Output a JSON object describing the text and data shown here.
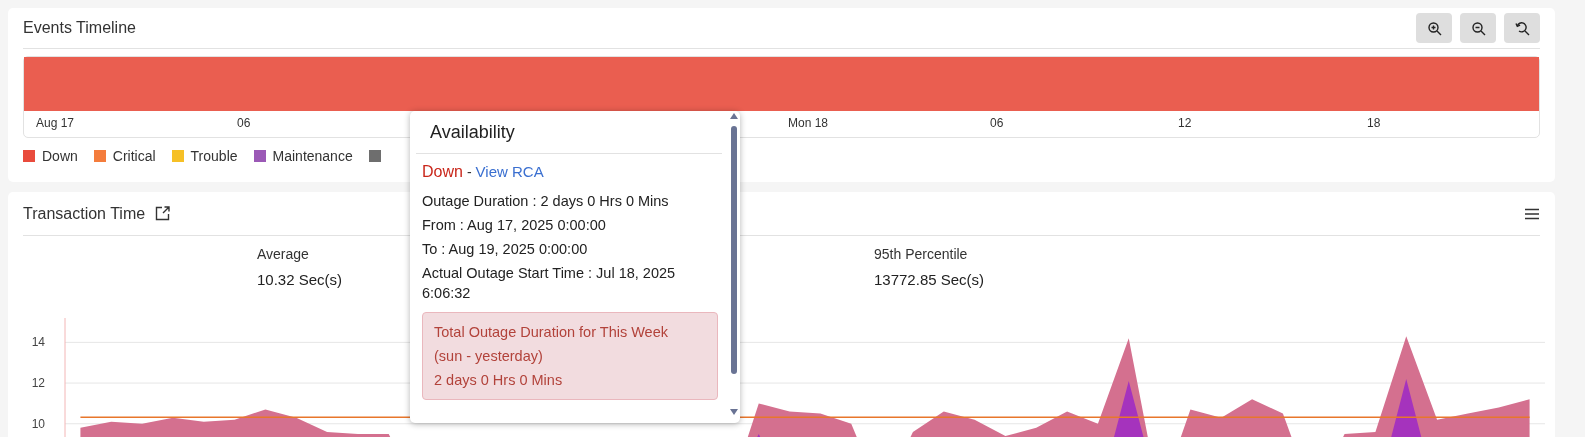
{
  "events_timeline": {
    "title": "Events Timeline",
    "toolbar": [
      {
        "kind": "zoom-in"
      },
      {
        "kind": "zoom-out"
      },
      {
        "kind": "reset"
      }
    ],
    "bar": {
      "color": "#ea5e50"
    },
    "axis_labels": [
      "Aug 17",
      "06",
      "Mon 18",
      "06",
      "12",
      "18"
    ],
    "legend": [
      {
        "label": "Down",
        "color": "#e94b3c"
      },
      {
        "label": "Critical",
        "color": "#f47c3c"
      },
      {
        "label": "Trouble",
        "color": "#f6c026"
      },
      {
        "label": "Maintenance",
        "color": "#9b59b6"
      },
      {
        "color": "#6e6e6e"
      }
    ]
  },
  "transaction_time": {
    "title": "Transaction Time",
    "stats": [
      {
        "label": "Average",
        "value": "10.32 Sec(s)"
      },
      {
        "label": "95th Percentile",
        "value": "13772.85 Sec(s)"
      }
    ],
    "chart_data": {
      "type": "area",
      "yticks": [
        10,
        12,
        14
      ],
      "ylim": [
        9.3,
        15.1
      ],
      "grid": true,
      "series": [
        {
          "color": "#d4708f",
          "values": [
            9.8,
            10.1,
            10.0,
            10.3,
            10.1,
            10.2,
            10.7,
            10.3,
            9.6,
            9.5,
            9.5,
            null,
            null,
            null,
            null,
            null,
            null,
            null,
            null,
            null,
            null,
            null,
            11.0,
            10.6,
            10.5,
            10.0,
            null,
            9.6,
            10.6,
            10.2,
            9.4,
            9.8,
            10.6,
            10.0,
            14.2,
            null,
            10.7,
            10.3,
            11.2,
            10.5,
            null,
            9.5,
            9.6,
            14.3,
            10.2,
            10.5,
            10.8,
            11.2
          ]
        },
        {
          "color": "#a533bd",
          "values": [
            null,
            null,
            null,
            null,
            null,
            null,
            null,
            null,
            null,
            null,
            null,
            null,
            null,
            null,
            null,
            null,
            null,
            null,
            null,
            null,
            null,
            null,
            9.5,
            null,
            null,
            null,
            null,
            null,
            null,
            null,
            null,
            null,
            null,
            null,
            12.1,
            null,
            null,
            null,
            null,
            null,
            null,
            null,
            null,
            12.2,
            null,
            null,
            null,
            null
          ]
        },
        {
          "type": "line",
          "color": "#e8762b",
          "values": [
            10.32,
            10.32,
            10.32,
            10.32,
            10.32,
            10.32,
            10.32,
            10.32,
            10.32,
            10.32,
            10.32,
            null,
            null,
            null,
            null,
            null,
            null,
            null,
            null,
            null,
            null,
            null,
            10.32,
            10.32,
            10.32,
            10.32,
            10.32,
            10.32,
            10.32,
            10.32,
            10.32,
            10.32,
            10.32,
            10.32,
            10.32,
            10.32,
            10.32,
            10.32,
            10.32,
            10.32,
            10.32,
            10.32,
            10.32,
            10.32,
            10.32,
            10.32,
            10.32,
            10.32
          ]
        }
      ]
    }
  },
  "tooltip": {
    "title": "Availability",
    "status": "Down",
    "separator": "-",
    "link": "View RCA",
    "lines": [
      "Outage Duration : 2 days 0 Hrs 0 Mins",
      "From : Aug 17, 2025 0:00:00",
      "To : Aug 19, 2025 0:00:00",
      "Actual Outage Start Time : Jul 18, 2025 6:06:32"
    ],
    "summary": [
      "Total Outage Duration for This Week",
      "(sun - yesterday)",
      "2 days 0 Hrs 0 Mins"
    ]
  }
}
